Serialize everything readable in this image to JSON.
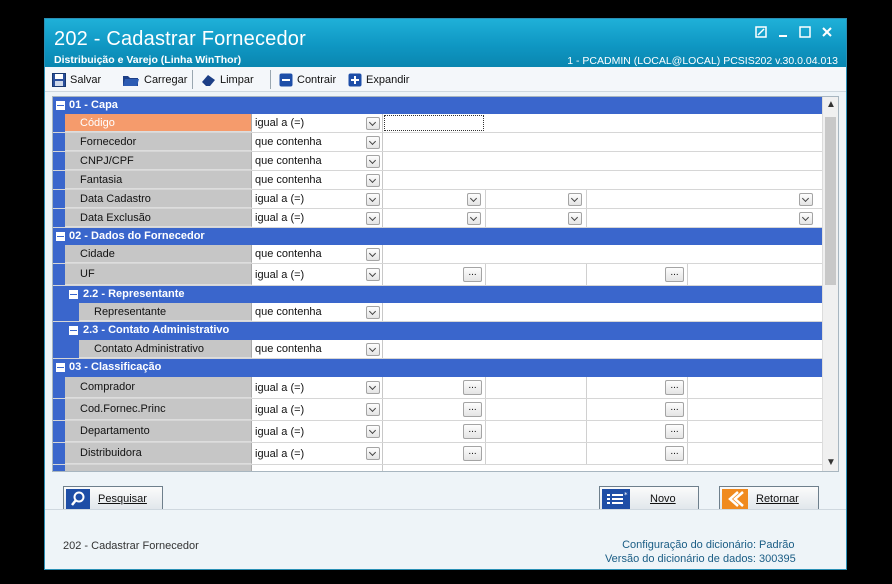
{
  "window": {
    "title": "202 - Cadastrar  Fornecedor",
    "subtitle": "Distribuição e Varejo (Linha WinThor)",
    "info": "1 - PCADMIN (LOCAL@LOCAL)   PCSIS202  v.30.0.04.013"
  },
  "toolbar": {
    "save": "Salvar",
    "load": "Carregar",
    "clear": "Limpar",
    "collapse": "Contrair",
    "expand": "Expandir"
  },
  "grid": {
    "sections": {
      "s1": "01 - Capa",
      "s2": "02 - Dados do Fornecedor",
      "s22": "2.2 - Representante",
      "s23": "2.3 - Contato Administrativo",
      "s3": "03 - Classificação"
    },
    "rows": [
      {
        "label": "Código",
        "condition": "igual a (=)"
      },
      {
        "label": "Fornecedor",
        "condition": "que contenha"
      },
      {
        "label": "CNPJ/CPF",
        "condition": "que contenha"
      },
      {
        "label": "Fantasia",
        "condition": "que contenha"
      },
      {
        "label": "Data Cadastro",
        "condition": "igual a (=)"
      },
      {
        "label": "Data Exclusão",
        "condition": "igual a (=)"
      },
      {
        "label": "Cidade",
        "condition": "que contenha"
      },
      {
        "label": "UF",
        "condition": "igual a (=)"
      },
      {
        "label": "Representante",
        "condition": "que contenha"
      },
      {
        "label": "Contato Administrativo",
        "condition": "que contenha"
      },
      {
        "label": "Comprador",
        "condition": "igual a (=)"
      },
      {
        "label": "Cod.Fornec.Princ",
        "condition": "igual a (=)"
      },
      {
        "label": "Departamento",
        "condition": "igual a (=)"
      },
      {
        "label": "Distribuidora",
        "condition": "igual a (=)"
      }
    ],
    "ellipsis": "..."
  },
  "buttons": {
    "search": "Pesquisar",
    "new": "Novo",
    "back": "Retornar"
  },
  "status": {
    "left": "202 - Cadastrar  Fornecedor",
    "dict_config_label": "Configuração do dicionário:",
    "dict_config_value": "Padrão",
    "dict_version_label": "Versão do dicionário de dados:",
    "dict_version_value": "300395"
  },
  "colors": {
    "section": "#3a66cc",
    "title_bar": "#0f97c3",
    "selected": "#f59b6c"
  }
}
